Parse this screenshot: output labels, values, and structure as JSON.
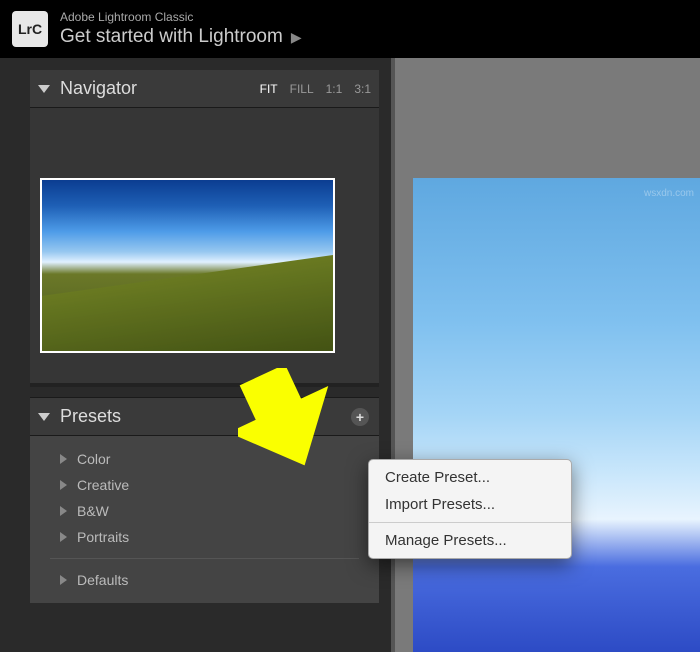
{
  "header": {
    "logo_text": "LrC",
    "app_name": "Adobe Lightroom Classic",
    "get_started": "Get started with Lightroom"
  },
  "navigator": {
    "title": "Navigator",
    "zoom_options": [
      "FIT",
      "FILL",
      "1:1",
      "3:1"
    ]
  },
  "presets": {
    "title": "Presets",
    "groups": [
      "Color",
      "Creative",
      "B&W",
      "Portraits"
    ],
    "defaults_label": "Defaults"
  },
  "context_menu": {
    "create": "Create Preset...",
    "import": "Import Presets...",
    "manage": "Manage Presets..."
  },
  "watermark": "wsxdn.com"
}
